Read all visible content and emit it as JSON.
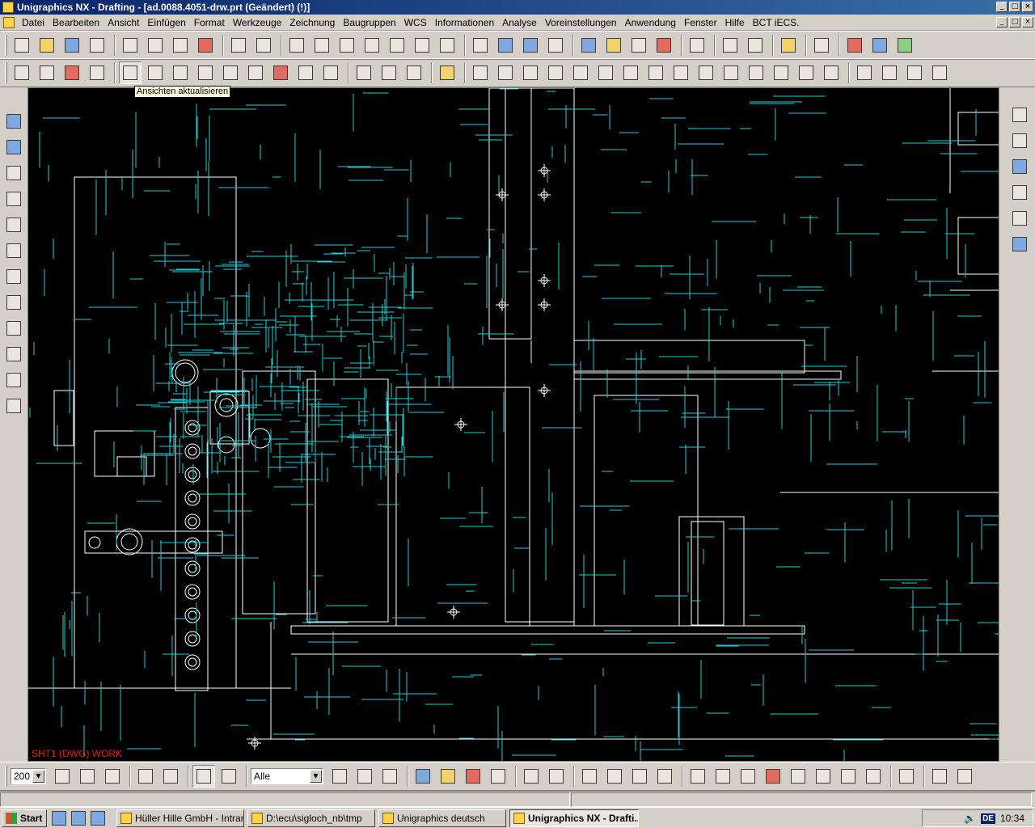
{
  "window": {
    "title": "Unigraphics NX - Drafting - [ad.0088.4051-drw.prt (Geändert)    (!)]",
    "app_icon": "ug-nx-icon"
  },
  "menu": {
    "items": [
      "Datei",
      "Bearbeiten",
      "Ansicht",
      "Einfügen",
      "Format",
      "Werkzeuge",
      "Zeichnung",
      "Baugruppen",
      "WCS",
      "Informationen",
      "Analyse",
      "Voreinstellungen",
      "Anwendung",
      "Fenster",
      "Hilfe",
      "BCT iECS."
    ]
  },
  "tooltip": {
    "text": "Ansichten aktualisieren"
  },
  "graphics": {
    "background": "#000000",
    "primary_line_color": "#ffffff",
    "dimension_line_color": "#20d0d8",
    "view_label": "SHT1 (DWG) WORK",
    "view_label_color": "#e01a1a"
  },
  "bottom_toolbar": {
    "scale_value": "200",
    "filter_value": "Alle"
  },
  "taskbar": {
    "start_label": "Start",
    "tasks": [
      {
        "label": "Hüller Hille GmbH - Intran...",
        "active": false
      },
      {
        "label": "D:\\ecu\\sigloch_nb\\tmp",
        "active": false
      },
      {
        "label": "Unigraphics deutsch",
        "active": false
      },
      {
        "label": "Unigraphics NX - Drafti...",
        "active": true
      }
    ],
    "language": "DE",
    "clock": "10:34"
  }
}
